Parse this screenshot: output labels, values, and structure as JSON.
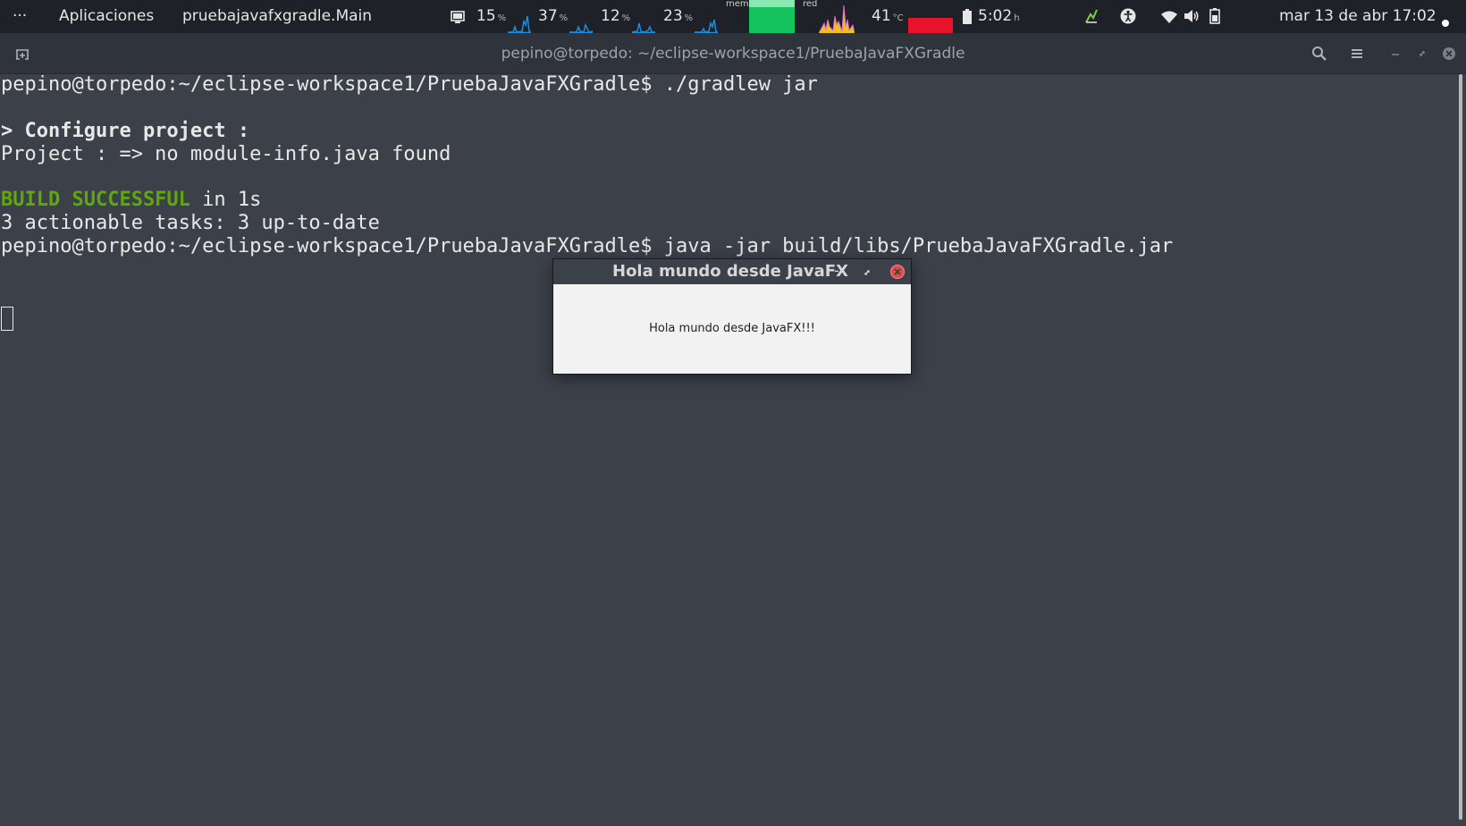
{
  "top_panel": {
    "activities": "···",
    "apps_menu": "Aplicaciones",
    "active_app": "pruebajavafxgradle.Main",
    "cpu_cores": [
      {
        "value": "15",
        "unit": "%"
      },
      {
        "value": "37",
        "unit": "%"
      },
      {
        "value": "12",
        "unit": "%"
      },
      {
        "value": "23",
        "unit": "%"
      }
    ],
    "mem_label": "mem",
    "net_label": "red",
    "temperature": {
      "value": "41",
      "unit": "°C"
    },
    "battery_time": {
      "value": "5:02",
      "unit": "h"
    },
    "datetime": "mar 13 de abr  17:02",
    "colors": {
      "cpu_graph": "#1a8fe3",
      "mem_bar": "#14c25e",
      "temp_bar": "#e8132a"
    }
  },
  "terminal": {
    "title": "pepino@torpedo: ~/eclipse-workspace1/PruebaJavaFXGradle",
    "lines": [
      {
        "text": "pepino@torpedo:~/eclipse-workspace1/PruebaJavaFXGradle$ ./gradlew jar"
      },
      {
        "text": ""
      },
      {
        "text": "> Configure project :"
      },
      {
        "text": "Project : => no module-info.java found"
      },
      {
        "text": ""
      },
      {
        "prefix": "BUILD SUCCESSFUL",
        "text": " in 1s"
      },
      {
        "text": "3 actionable tasks: 3 up-to-date"
      },
      {
        "text": "pepino@torpedo:~/eclipse-workspace1/PruebaJavaFXGradle$ java -jar build/libs/PruebaJavaFXGradle.jar"
      }
    ]
  },
  "dialog": {
    "title": "Hola mundo desde JavaFX",
    "minimize": "-",
    "message": "Hola mundo desde JavaFX!!!"
  }
}
